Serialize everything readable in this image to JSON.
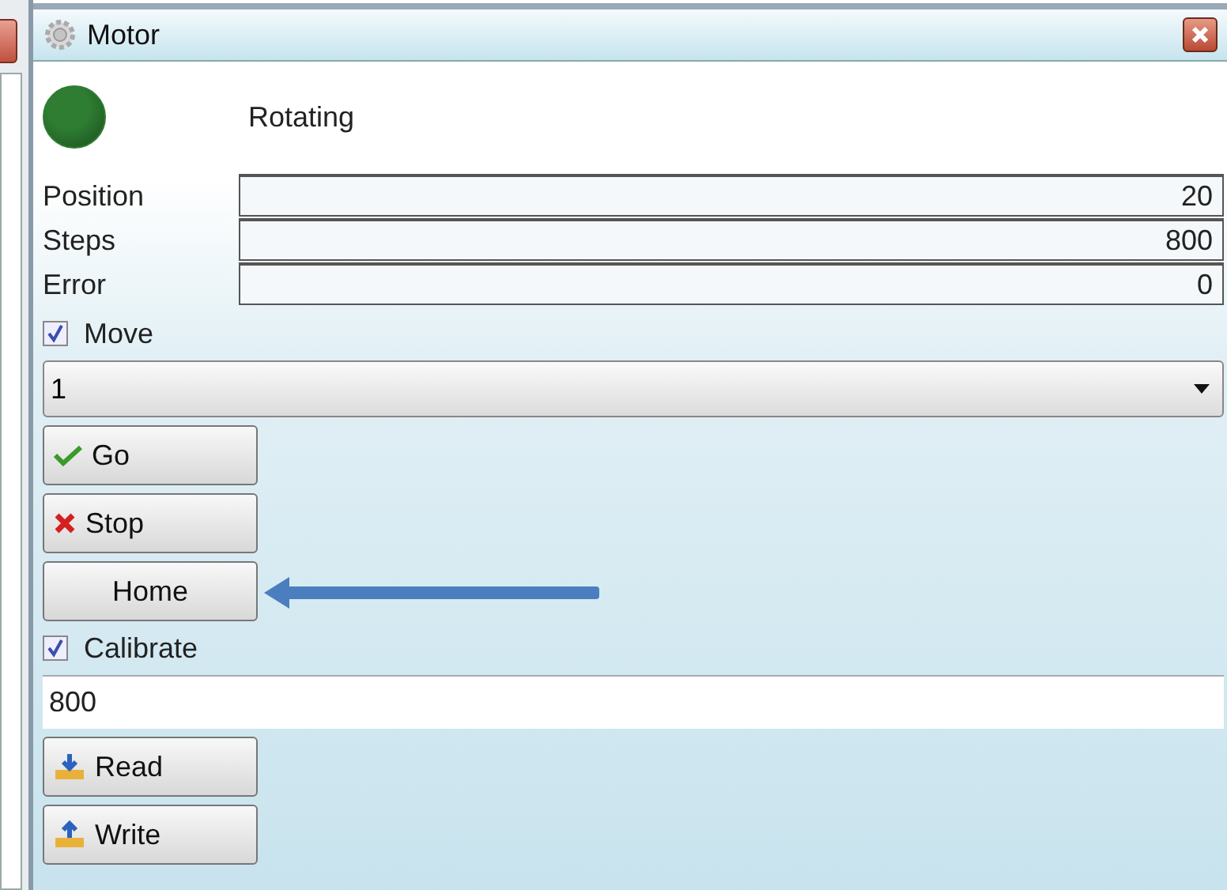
{
  "window": {
    "title": "Motor"
  },
  "status": {
    "text": "Rotating",
    "color": "#2e7d32"
  },
  "fields": [
    {
      "label": "Position",
      "value": "20"
    },
    {
      "label": "Steps",
      "value": "800"
    },
    {
      "label": "Error",
      "value": "0"
    }
  ],
  "move": {
    "label": "Move",
    "checked": true
  },
  "dropdown": {
    "value": "1"
  },
  "move_buttons": [
    {
      "label": "Go",
      "kind": "check"
    },
    {
      "label": "Stop",
      "kind": "cross"
    },
    {
      "label": "Home",
      "kind": "plain"
    }
  ],
  "calibrate": {
    "label": "Calibrate",
    "checked": true
  },
  "calibrate_input": {
    "value": "800"
  },
  "calibrate_buttons": [
    {
      "label": "Read",
      "kind": "download"
    },
    {
      "label": "Write",
      "kind": "upload"
    }
  ]
}
